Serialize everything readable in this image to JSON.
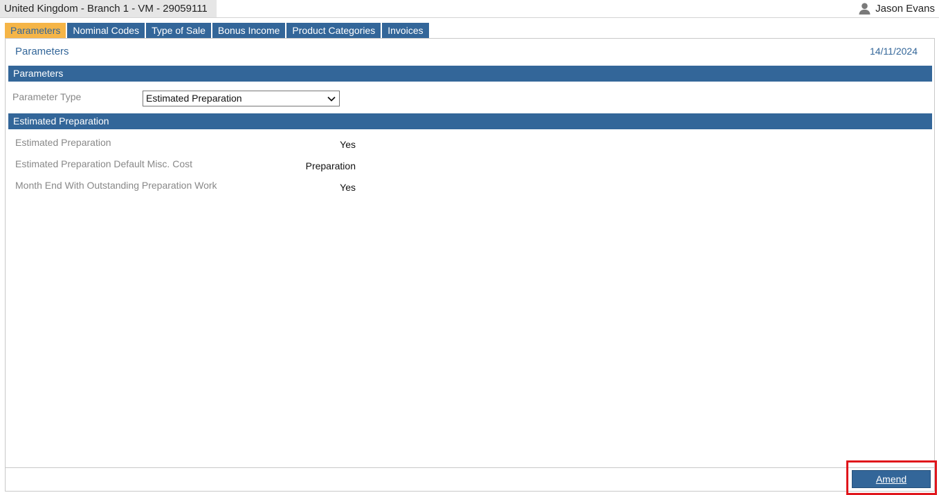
{
  "header": {
    "branch": "United Kingdom - Branch 1 - VM - 29059111",
    "user_name": "Jason Evans",
    "user_icon": "user-icon"
  },
  "tabs": [
    {
      "label": "Parameters",
      "active": true
    },
    {
      "label": "Nominal Codes",
      "active": false
    },
    {
      "label": "Type of Sale",
      "active": false
    },
    {
      "label": "Bonus Income",
      "active": false
    },
    {
      "label": "Product Categories",
      "active": false
    },
    {
      "label": "Invoices",
      "active": false
    }
  ],
  "page": {
    "title": "Parameters",
    "date": "14/11/2024"
  },
  "parameters_section": {
    "header": "Parameters",
    "type_label": "Parameter Type",
    "type_value": "Estimated Preparation"
  },
  "estimated_section": {
    "header": "Estimated Preparation",
    "rows": [
      {
        "label": "Estimated Preparation",
        "value": "Yes"
      },
      {
        "label": "Estimated Preparation Default Misc. Cost",
        "value": "Preparation"
      },
      {
        "label": "Month End With Outstanding Preparation Work",
        "value": "Yes"
      }
    ]
  },
  "actions": {
    "amend_label": "Amend"
  },
  "colors": {
    "primary": "#336699",
    "active_tab": "#f5b547",
    "highlight": "#e0151b"
  }
}
